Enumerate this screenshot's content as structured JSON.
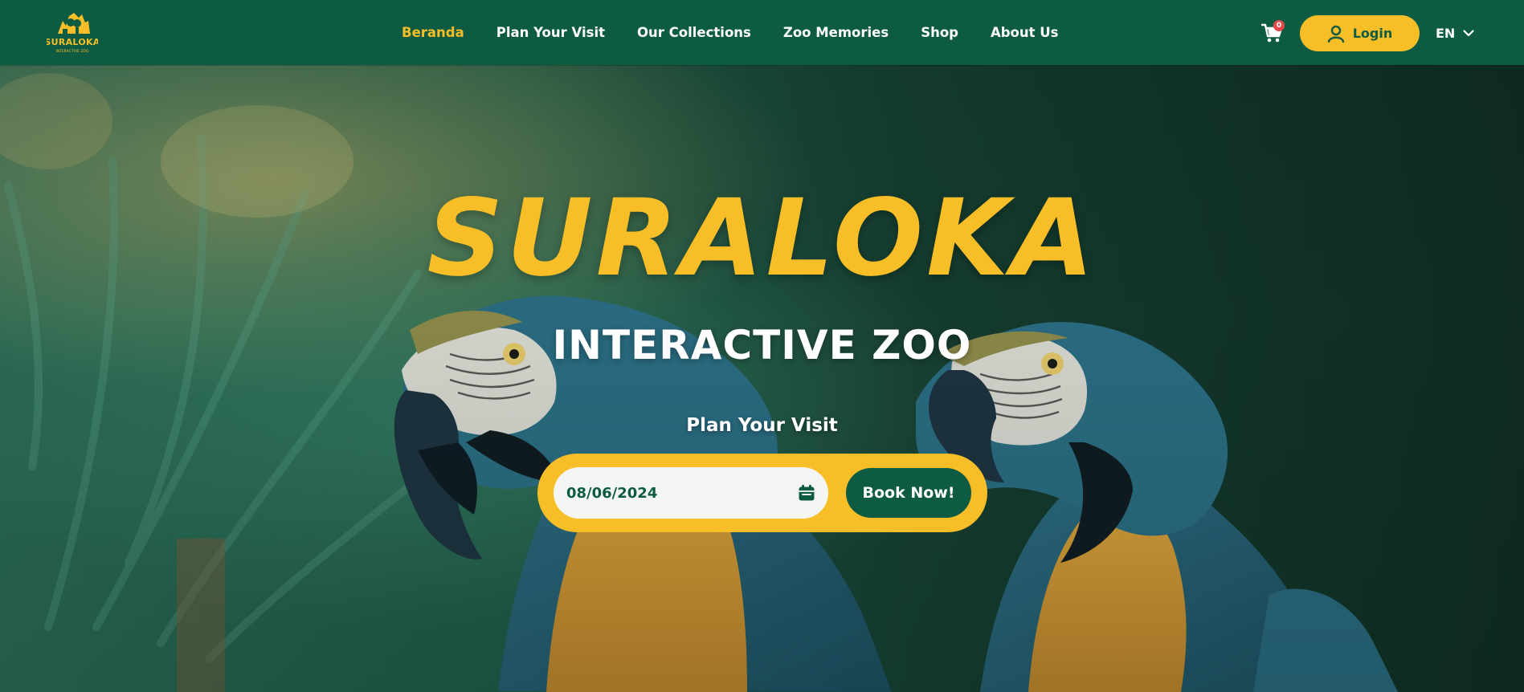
{
  "brand": {
    "logo_text": "SURALOKA",
    "logo_subtext": "INTERACTIVE ZOO",
    "accent_color": "#f7be27",
    "primary_color": "#0d5b43"
  },
  "nav": {
    "items": [
      {
        "label": "Beranda",
        "active": true
      },
      {
        "label": "Plan Your Visit",
        "active": false
      },
      {
        "label": "Our Collections",
        "active": false
      },
      {
        "label": "Zoo Memories",
        "active": false
      },
      {
        "label": "Shop",
        "active": false
      },
      {
        "label": "About Us",
        "active": false
      }
    ],
    "cart_icon": "cart-icon",
    "cart_count": "0",
    "login_label": "Login",
    "user_icon": "user-icon",
    "language": "EN",
    "language_icon": "chevron-down-icon"
  },
  "hero": {
    "title": "SURALOKA",
    "subtitle": "INTERACTIVE ZOO",
    "plan_label": "Plan Your Visit",
    "date_value": "08/06/2024",
    "calendar_icon": "calendar-icon",
    "book_label": "Book Now!",
    "background": "blue-and-gold-macaw-parrots-photo"
  }
}
